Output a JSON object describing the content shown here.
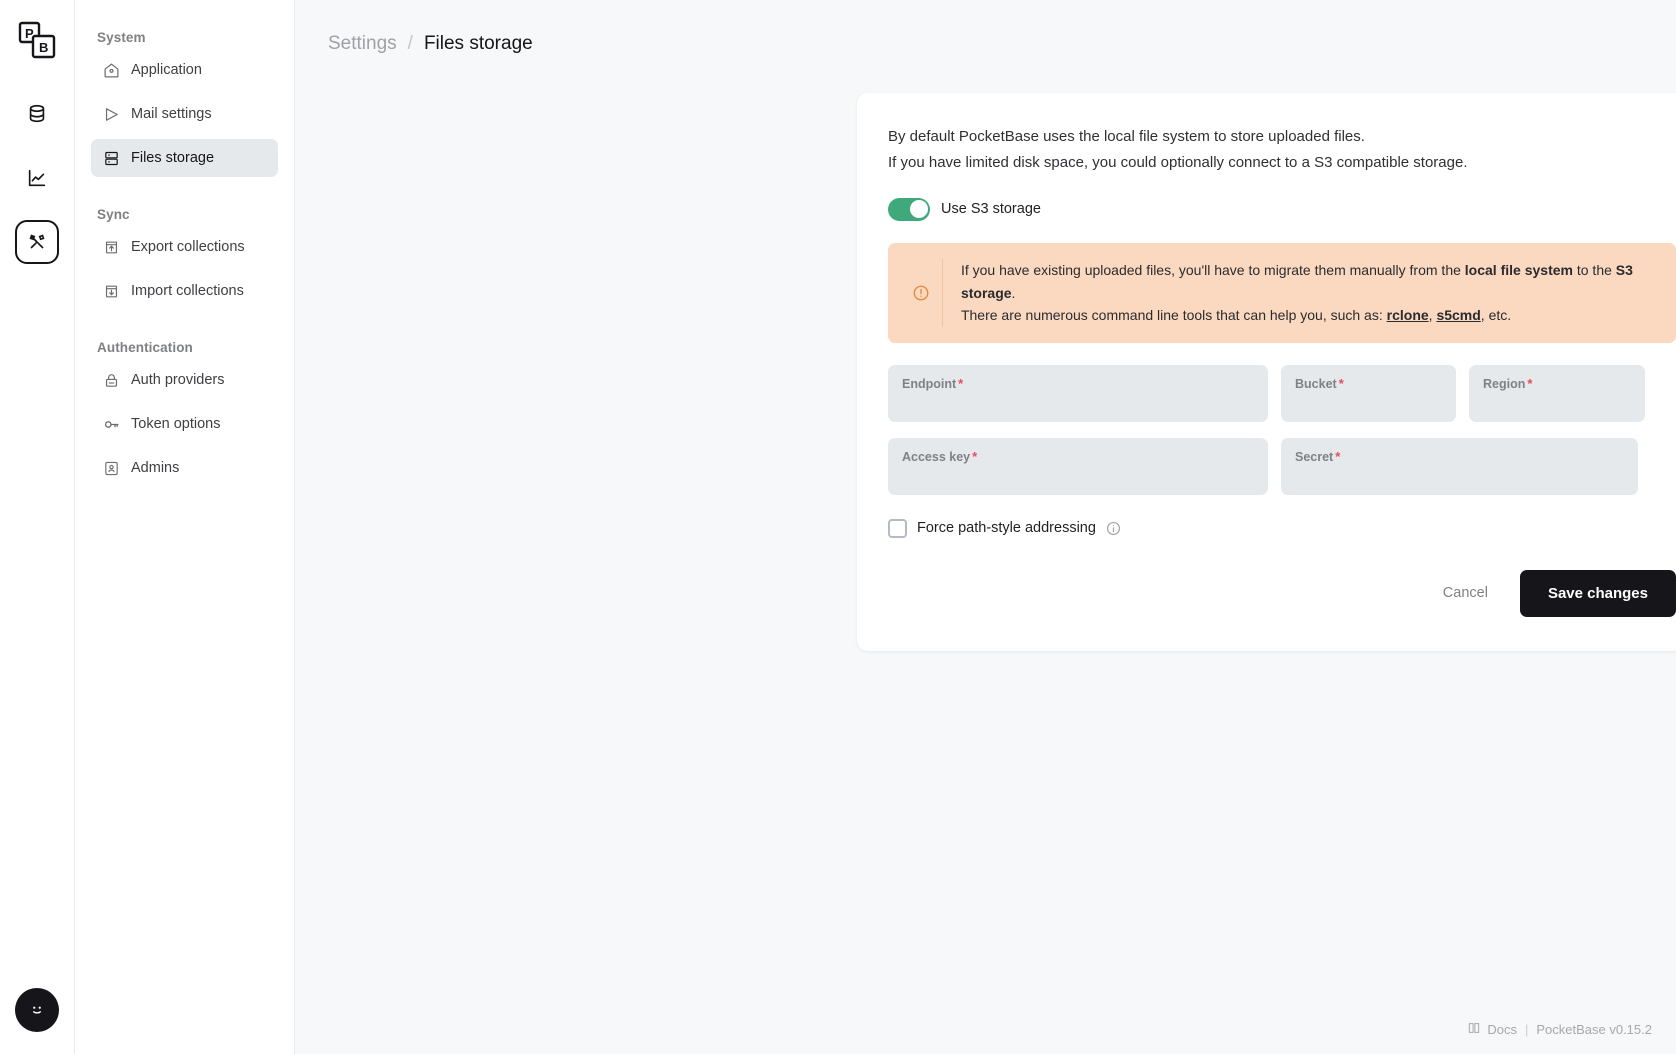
{
  "rail": {
    "logo": "pocketbase-logo",
    "items": [
      {
        "icon": "database-icon",
        "name": "collections"
      },
      {
        "icon": "chart-line-icon",
        "name": "logs"
      },
      {
        "icon": "tools-icon",
        "name": "settings",
        "active": true
      }
    ],
    "avatar": "admin-avatar-smiley"
  },
  "sidebar": {
    "groups": [
      {
        "title": "System",
        "items": [
          {
            "label": "Application",
            "icon": "home-gear-icon",
            "active": false
          },
          {
            "label": "Mail settings",
            "icon": "send-plane-icon",
            "active": false
          },
          {
            "label": "Files storage",
            "icon": "server-icon",
            "active": true
          }
        ]
      },
      {
        "title": "Sync",
        "items": [
          {
            "label": "Export collections",
            "icon": "upload-box-icon",
            "active": false
          },
          {
            "label": "Import collections",
            "icon": "download-box-icon",
            "active": false
          }
        ]
      },
      {
        "title": "Authentication",
        "items": [
          {
            "label": "Auth providers",
            "icon": "lock-icon",
            "active": false
          },
          {
            "label": "Token options",
            "icon": "key-icon",
            "active": false
          },
          {
            "label": "Admins",
            "icon": "user-badge-icon",
            "active": false
          }
        ]
      }
    ]
  },
  "breadcrumb": {
    "parent": "Settings",
    "separator": "/",
    "current": "Files storage"
  },
  "card": {
    "intro_line1": "By default PocketBase uses the local file system to store uploaded files.",
    "intro_line2": "If you have limited disk space, you could optionally connect to a S3 compatible storage.",
    "toggle": {
      "label": "Use S3 storage",
      "enabled": true,
      "on_color": "#3fa97b"
    },
    "alert": {
      "icon": "alert-circle-icon",
      "accent_color": "#e3883f",
      "background_color": "#fbd9c0",
      "line1_part1": "If you have existing uploaded files, you'll have to migrate them manually from the ",
      "line1_bold1": "local file system",
      "line1_part2": " to the ",
      "line1_bold2": "S3 storage",
      "line1_part3": ".",
      "line2_part1": "There are numerous command line tools that can help you, such as: ",
      "line2_link1": "rclone",
      "line2_sep1": ", ",
      "line2_link2": "s5cmd",
      "line2_part2": ", etc."
    },
    "fields": [
      {
        "label": "Endpoint",
        "required": true,
        "value": "",
        "placeholder": ""
      },
      {
        "label": "Bucket",
        "required": true,
        "value": "",
        "placeholder": ""
      },
      {
        "label": "Region",
        "required": true,
        "value": "",
        "placeholder": ""
      },
      {
        "label": "Access key",
        "required": true,
        "value": "",
        "placeholder": ""
      },
      {
        "label": "Secret",
        "required": true,
        "value": "",
        "placeholder": ""
      }
    ],
    "required_marker": "*",
    "checkbox": {
      "label": "Force path-style addressing",
      "checked": false,
      "info_icon": "info-circle-icon"
    },
    "cancel_label": "Cancel",
    "save_label": "Save changes"
  },
  "footer": {
    "docs_icon": "book-icon",
    "docs_label": "Docs",
    "separator": "|",
    "version": "PocketBase v0.15.2"
  }
}
